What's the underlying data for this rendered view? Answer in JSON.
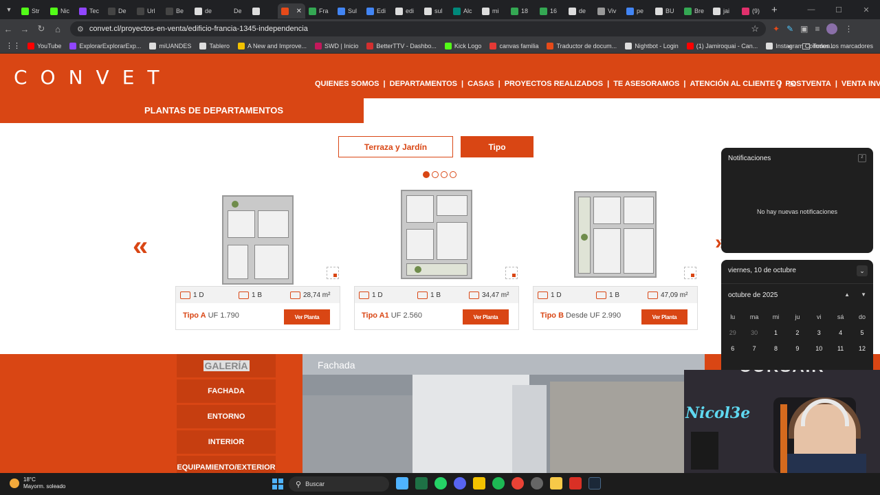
{
  "browser": {
    "tabs": [
      {
        "label": "Str",
        "color": "#53fc18"
      },
      {
        "label": "Nic",
        "color": "#53fc18"
      },
      {
        "label": "Tec",
        "color": "#9146ff"
      },
      {
        "label": "De",
        "color": "#444444"
      },
      {
        "label": "Url",
        "color": "#444444"
      },
      {
        "label": "Be",
        "color": "#444444"
      },
      {
        "label": "de",
        "color": "#dddddd"
      },
      {
        "label": "De",
        "color": "#202124"
      },
      {
        "label": "",
        "color": "#dddddd"
      },
      {
        "label": "",
        "color": "#e64a19",
        "active": true
      },
      {
        "label": "Fra",
        "color": "#34a853"
      },
      {
        "label": "Sul",
        "color": "#4285f4"
      },
      {
        "label": "Edi",
        "color": "#4285f4"
      },
      {
        "label": "edi",
        "color": "#dddddd"
      },
      {
        "label": "sul",
        "color": "#dddddd"
      },
      {
        "label": "Alc",
        "color": "#00897b"
      },
      {
        "label": "mi",
        "color": "#dddddd"
      },
      {
        "label": "18",
        "color": "#34a853"
      },
      {
        "label": "16",
        "color": "#34a853"
      },
      {
        "label": "de",
        "color": "#dddddd"
      },
      {
        "label": "Viv",
        "color": "#999999"
      },
      {
        "label": "pe",
        "color": "#4285f4"
      },
      {
        "label": "BU",
        "color": "#dddddd"
      },
      {
        "label": "Bre",
        "color": "#34a853"
      },
      {
        "label": "jai",
        "color": "#dddddd"
      },
      {
        "label": "(9)",
        "color": "#e1306c"
      }
    ],
    "url": "convet.cl/proyectos-en-venta/edificio-francia-1345-independencia",
    "bookmarks": [
      {
        "label": "YouTube",
        "color": "#ff0000"
      },
      {
        "label": "ExplorarExplorarExp...",
        "color": "#9146ff"
      },
      {
        "label": "miUANDES",
        "color": "#dddddd"
      },
      {
        "label": "Tablero",
        "color": "#dddddd"
      },
      {
        "label": "A New and Improve...",
        "color": "#f2c200"
      },
      {
        "label": "SWD | Inicio",
        "color": "#c2185b"
      },
      {
        "label": "BetterTTV - Dashbo...",
        "color": "#d32f2f"
      },
      {
        "label": "Kick Logo",
        "color": "#53fc18"
      },
      {
        "label": "canvas familia",
        "color": "#e53935"
      },
      {
        "label": "Traductor de docum...",
        "color": "#e64a19"
      },
      {
        "label": "Nightbot - Login",
        "color": "#dddddd"
      },
      {
        "label": "(1) Jamiroquai - Can...",
        "color": "#ff0000"
      },
      {
        "label": "Instagram Commen...",
        "color": "#dddddd"
      }
    ],
    "all_bookmarks": "Todos los marcadores"
  },
  "site": {
    "logo": "CONVET",
    "nav": [
      "QUIENES SOMOS",
      "DEPARTAMENTOS",
      "CASAS",
      "PROYECTOS REALIZADOS",
      "TE ASESORAMOS",
      "ATENCIÓN AL CLIENTE",
      "POSTVENTA",
      "VENTA INVERSIONISTAS"
    ],
    "nav_sep": "|",
    "section_title": "PLANTAS DE DEPARTAMENTOS",
    "filter_outline": "Terraza y Jardín",
    "filter_active": "Tipo",
    "carousel_dots": 4,
    "arrow_left": "«",
    "arrow_right": "»",
    "cards": [
      {
        "bedrooms": "1 D",
        "bathrooms": "1 B",
        "area": "28,74 m²",
        "type": "Tipo A",
        "price": "UF 1.790",
        "button": "Ver Planta"
      },
      {
        "bedrooms": "1 D",
        "bathrooms": "1 B",
        "area": "34,47 m²",
        "type": "Tipo A1",
        "price": "UF 2.560",
        "button": "Ver Planta"
      },
      {
        "bedrooms": "1 D",
        "bathrooms": "1 B",
        "area": "47,09 m²",
        "type": "Tipo B",
        "price": "Desde UF 2.990",
        "button": "Ver Planta"
      }
    ],
    "gallery_title": "GALERÍA",
    "gallery_items": [
      "FACHADA",
      "ENTORNO",
      "INTERIOR",
      "EQUIPAMIENTO/EXTERIOR"
    ],
    "photo_label": "Fachada"
  },
  "notifications": {
    "title": "Notificaciones",
    "empty": "No hay nuevas notificaciones"
  },
  "calendar": {
    "date": "viernes, 10 de octubre",
    "month": "octubre de 2025",
    "weekdays": [
      "lu",
      "ma",
      "mi",
      "ju",
      "vi",
      "sá",
      "do"
    ],
    "days": [
      "29",
      "30",
      "1",
      "2",
      "3",
      "4",
      "5",
      "6",
      "7",
      "8",
      "9",
      "10",
      "11",
      "12"
    ]
  },
  "webcam": {
    "neon": "Nicol3e",
    "brand": "CORSAIR"
  },
  "taskbar": {
    "temp": "18°C",
    "weather": "Mayorm. soleado",
    "search": "Buscar"
  }
}
